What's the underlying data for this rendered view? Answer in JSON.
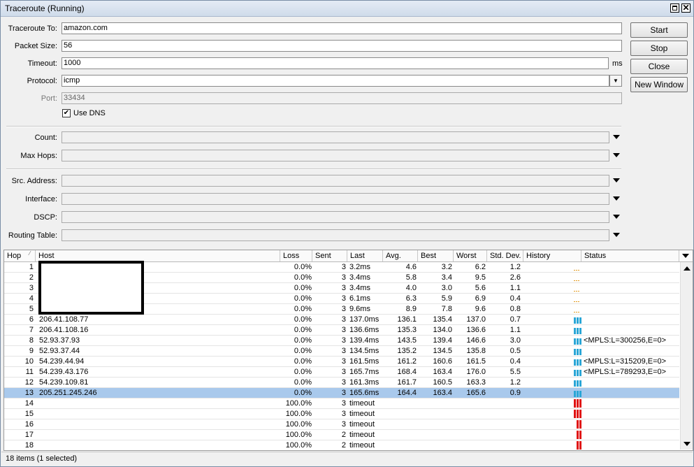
{
  "window": {
    "title": "Traceroute (Running)"
  },
  "form": {
    "traceroute_to": {
      "label": "Traceroute To:",
      "value": "amazon.com"
    },
    "packet_size": {
      "label": "Packet Size:",
      "value": "56"
    },
    "timeout": {
      "label": "Timeout:",
      "value": "1000",
      "unit": "ms"
    },
    "protocol": {
      "label": "Protocol:",
      "value": "icmp"
    },
    "port": {
      "label": "Port:",
      "value": "33434"
    },
    "use_dns": {
      "label": "Use DNS",
      "checked": true
    },
    "count": {
      "label": "Count:",
      "value": ""
    },
    "max_hops": {
      "label": "Max Hops:",
      "value": ""
    },
    "src_address": {
      "label": "Src. Address:",
      "value": ""
    },
    "interface": {
      "label": "Interface:",
      "value": ""
    },
    "dscp": {
      "label": "DSCP:",
      "value": ""
    },
    "routing_table": {
      "label": "Routing Table:",
      "value": ""
    }
  },
  "buttons": {
    "start": "Start",
    "stop": "Stop",
    "close": "Close",
    "new_window": "New Window"
  },
  "table": {
    "columns": [
      "Hop",
      "Host",
      "Loss",
      "Sent",
      "Last",
      "Avg.",
      "Best",
      "Worst",
      "Std. Dev.",
      "History",
      "Status"
    ],
    "rows": [
      {
        "hop": "1",
        "host": "",
        "loss": "0.0%",
        "sent": "3",
        "last": "3.2ms",
        "avg": "4.6",
        "best": "3.2",
        "worst": "6.2",
        "std": "1.2",
        "status": "",
        "history": "low"
      },
      {
        "hop": "2",
        "host": "",
        "loss": "0.0%",
        "sent": "3",
        "last": "3.4ms",
        "avg": "5.8",
        "best": "3.4",
        "worst": "9.5",
        "std": "2.6",
        "status": "",
        "history": "low"
      },
      {
        "hop": "3",
        "host": "",
        "loss": "0.0%",
        "sent": "3",
        "last": "3.4ms",
        "avg": "4.0",
        "best": "3.0",
        "worst": "5.6",
        "std": "1.1",
        "status": "",
        "history": "low"
      },
      {
        "hop": "4",
        "host": "",
        "loss": "0.0%",
        "sent": "3",
        "last": "6.1ms",
        "avg": "6.3",
        "best": "5.9",
        "worst": "6.9",
        "std": "0.4",
        "status": "",
        "history": "low"
      },
      {
        "hop": "5",
        "host": "",
        "loss": "0.0%",
        "sent": "3",
        "last": "9.6ms",
        "avg": "8.9",
        "best": "7.8",
        "worst": "9.6",
        "std": "0.8",
        "status": "",
        "history": "low"
      },
      {
        "hop": "6",
        "host": "206.41.108.77",
        "loss": "0.0%",
        "sent": "3",
        "last": "137.0ms",
        "avg": "136.1",
        "best": "135.4",
        "worst": "137.0",
        "std": "0.7",
        "status": "",
        "history": "ok"
      },
      {
        "hop": "7",
        "host": "206.41.108.16",
        "loss": "0.0%",
        "sent": "3",
        "last": "136.6ms",
        "avg": "135.3",
        "best": "134.0",
        "worst": "136.6",
        "std": "1.1",
        "status": "",
        "history": "ok"
      },
      {
        "hop": "8",
        "host": "52.93.37.93",
        "loss": "0.0%",
        "sent": "3",
        "last": "139.4ms",
        "avg": "143.5",
        "best": "139.4",
        "worst": "146.6",
        "std": "3.0",
        "status": "<MPLS:L=300256,E=0>",
        "history": "ok"
      },
      {
        "hop": "9",
        "host": "52.93.37.44",
        "loss": "0.0%",
        "sent": "3",
        "last": "134.5ms",
        "avg": "135.2",
        "best": "134.5",
        "worst": "135.8",
        "std": "0.5",
        "status": "",
        "history": "ok"
      },
      {
        "hop": "10",
        "host": "54.239.44.94",
        "loss": "0.0%",
        "sent": "3",
        "last": "161.5ms",
        "avg": "161.2",
        "best": "160.6",
        "worst": "161.5",
        "std": "0.4",
        "status": "<MPLS:L=315209,E=0>",
        "history": "ok"
      },
      {
        "hop": "11",
        "host": "54.239.43.176",
        "loss": "0.0%",
        "sent": "3",
        "last": "165.7ms",
        "avg": "168.4",
        "best": "163.4",
        "worst": "176.0",
        "std": "5.5",
        "status": "<MPLS:L=789293,E=0>",
        "history": "ok"
      },
      {
        "hop": "12",
        "host": "54.239.109.81",
        "loss": "0.0%",
        "sent": "3",
        "last": "161.3ms",
        "avg": "161.7",
        "best": "160.5",
        "worst": "163.3",
        "std": "1.2",
        "status": "",
        "history": "ok"
      },
      {
        "hop": "13",
        "host": "205.251.245.246",
        "loss": "0.0%",
        "sent": "3",
        "last": "165.6ms",
        "avg": "164.4",
        "best": "163.4",
        "worst": "165.6",
        "std": "0.9",
        "status": "",
        "history": "ok",
        "selected": true
      },
      {
        "hop": "14",
        "host": "",
        "loss": "100.0%",
        "sent": "3",
        "last": "timeout",
        "avg": "",
        "best": "",
        "worst": "",
        "std": "",
        "status": "",
        "history": "timeout3"
      },
      {
        "hop": "15",
        "host": "",
        "loss": "100.0%",
        "sent": "3",
        "last": "timeout",
        "avg": "",
        "best": "",
        "worst": "",
        "std": "",
        "status": "",
        "history": "timeout3"
      },
      {
        "hop": "16",
        "host": "",
        "loss": "100.0%",
        "sent": "3",
        "last": "timeout",
        "avg": "",
        "best": "",
        "worst": "",
        "std": "",
        "status": "",
        "history": "timeout2"
      },
      {
        "hop": "17",
        "host": "",
        "loss": "100.0%",
        "sent": "2",
        "last": "timeout",
        "avg": "",
        "best": "",
        "worst": "",
        "std": "",
        "status": "",
        "history": "timeout2"
      },
      {
        "hop": "18",
        "host": "",
        "loss": "100.0%",
        "sent": "2",
        "last": "timeout",
        "avg": "",
        "best": "",
        "worst": "",
        "std": "",
        "status": "",
        "history": "timeout2"
      }
    ]
  },
  "colors": {
    "ok_bar": "#2aa6d6",
    "timeout_bar": "#e01010",
    "low_dash": "#e39a1e",
    "selected_row": "#a9c9ec"
  },
  "statusbar": {
    "text": "18 items (1 selected)"
  }
}
